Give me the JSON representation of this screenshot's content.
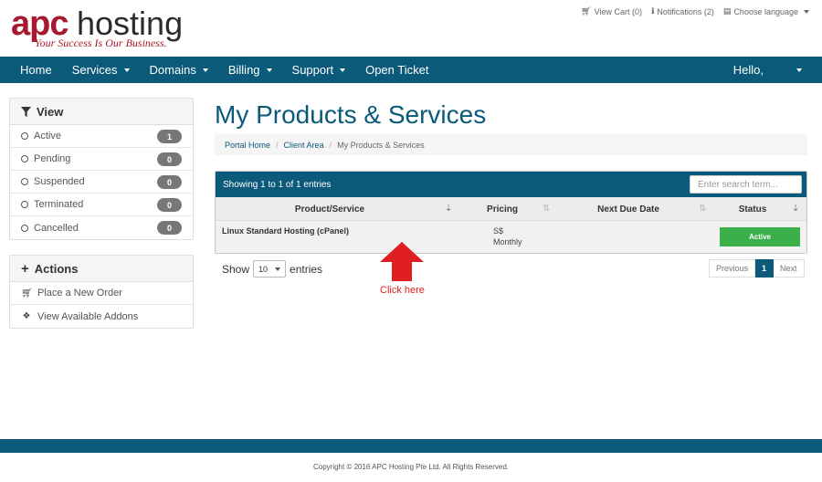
{
  "brand": {
    "logo_apc": "apc",
    "logo_hosting": "hosting",
    "tagline": "Your Success Is Our Business.",
    "primary_color": "#0b5a7a",
    "logo_red": "#a6192e"
  },
  "top_links": {
    "view_cart": "View Cart (0)",
    "notifications": "Notifications (2)",
    "language": "Choose language"
  },
  "nav": {
    "home": "Home",
    "services": "Services",
    "domains": "Domains",
    "billing": "Billing",
    "support": "Support",
    "open_ticket": "Open Ticket",
    "hello": "Hello,"
  },
  "sidebar": {
    "view_title": "View",
    "view_items": [
      {
        "label": "Active",
        "count": "1"
      },
      {
        "label": "Pending",
        "count": "0"
      },
      {
        "label": "Suspended",
        "count": "0"
      },
      {
        "label": "Terminated",
        "count": "0"
      },
      {
        "label": "Cancelled",
        "count": "0"
      }
    ],
    "actions_title": "Actions",
    "action_items": [
      {
        "label": "Place a New Order",
        "icon": "cart-icon"
      },
      {
        "label": "View Available Addons",
        "icon": "cubes-icon"
      }
    ]
  },
  "main": {
    "title": "My Products & Services",
    "breadcrumb": [
      "Portal Home",
      "Client Area",
      "My Products & Services"
    ],
    "showing": "Showing 1 to 1 of 1 entries",
    "search_placeholder": "Enter search term...",
    "columns": [
      "Product/Service",
      "Pricing",
      "Next Due Date",
      "Status"
    ],
    "rows": [
      {
        "product": "Linux Standard Hosting (cPanel)",
        "price": "S$",
        "cycle": "Monthly",
        "due": "",
        "status": "Active"
      }
    ],
    "show_label": "Show",
    "show_value": "10",
    "entries_label": "entries",
    "pager": {
      "prev": "Previous",
      "current": "1",
      "next": "Next"
    },
    "annotation": "Click here",
    "status_color": "#3bb04a",
    "annotation_color": "#e02020"
  },
  "footer": {
    "copyright": "Copyright © 2016 APC Hosting Pte Ltd. All Rights Reserved."
  }
}
